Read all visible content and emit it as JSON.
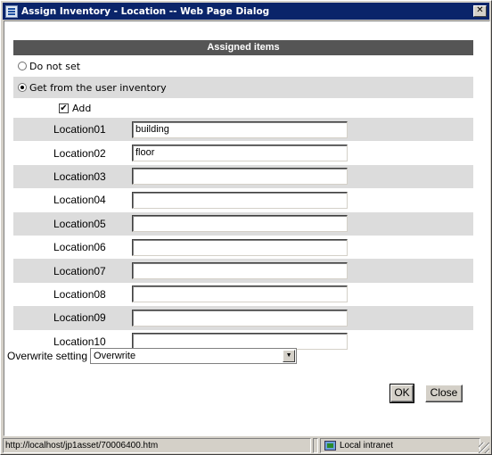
{
  "window": {
    "title": "Assign Inventory - Location -- Web Page Dialog",
    "close_glyph": "✕"
  },
  "section": {
    "header": "Assigned items"
  },
  "radios": [
    {
      "label": "Do not set",
      "checked": false
    },
    {
      "label": "Get from the user inventory",
      "checked": true
    }
  ],
  "add_checkbox": {
    "label": "Add",
    "checked": true,
    "glyph": "✔"
  },
  "locations": [
    {
      "label": "Location01",
      "value": "building"
    },
    {
      "label": "Location02",
      "value": "floor"
    },
    {
      "label": "Location03",
      "value": ""
    },
    {
      "label": "Location04",
      "value": ""
    },
    {
      "label": "Location05",
      "value": ""
    },
    {
      "label": "Location06",
      "value": ""
    },
    {
      "label": "Location07",
      "value": ""
    },
    {
      "label": "Location08",
      "value": ""
    },
    {
      "label": "Location09",
      "value": ""
    },
    {
      "label": "Location10",
      "value": ""
    }
  ],
  "overwrite": {
    "label": "Overwrite setting",
    "selected": "Overwrite",
    "arrow": "▼"
  },
  "buttons": {
    "ok": "OK",
    "close": "Close"
  },
  "statusbar": {
    "url": "http://localhost/jp1asset/70006400.htm",
    "zone": "Local intranet"
  },
  "colors": {
    "titlebar": "#0a246a",
    "header_bg": "#555555",
    "row_alt": "#dcdcdc",
    "chrome": "#d4d0c8"
  }
}
